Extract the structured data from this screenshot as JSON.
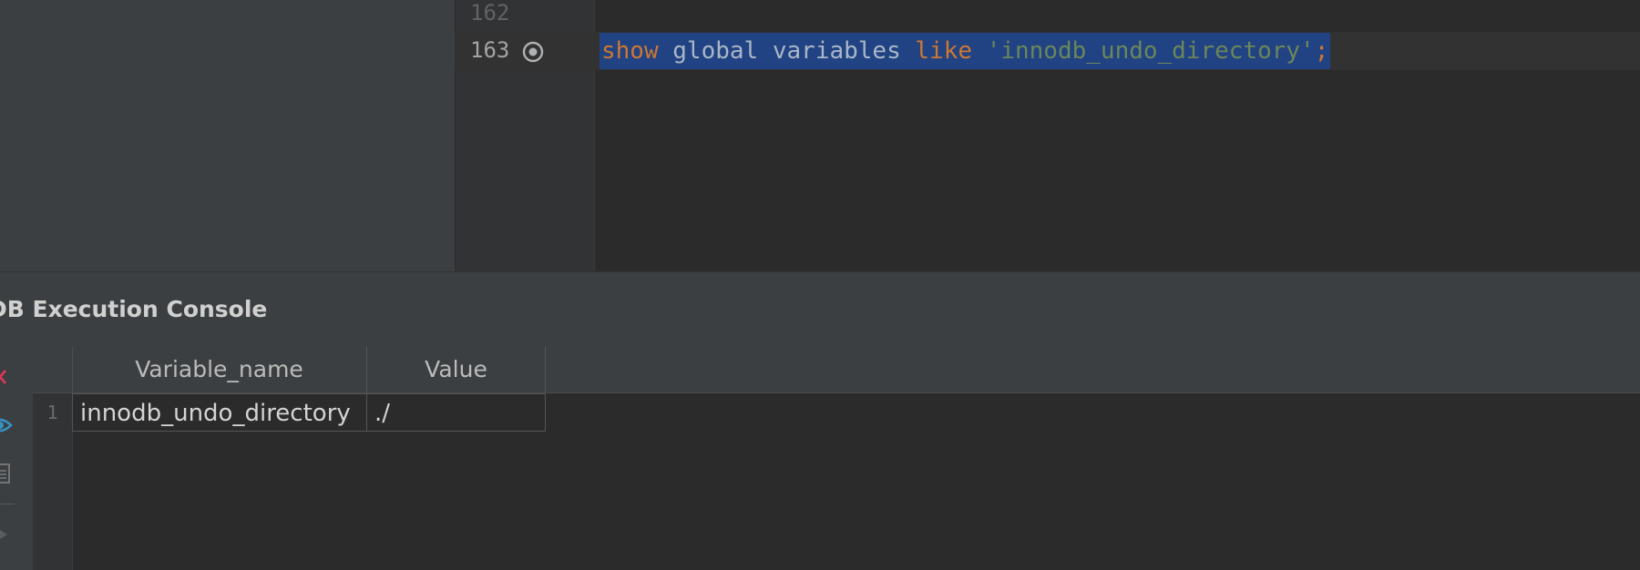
{
  "editor": {
    "lines": [
      {
        "number": "162"
      },
      {
        "number": "163"
      }
    ],
    "code": {
      "kw_show": "show",
      "id_global": "global",
      "id_variables": "variables",
      "kw_like": "like",
      "str_value": "'innodb_undo_directory'",
      "punct": ";"
    },
    "exec_icon": "execute-statement-icon"
  },
  "console": {
    "title": "DB Execution Console",
    "toolbar_icons": [
      "close-icon",
      "eye-icon",
      "document-icon",
      "play-icon"
    ]
  },
  "results": {
    "columns": [
      "Variable_name",
      "Value"
    ],
    "rows": [
      {
        "index": "1",
        "cells": [
          "innodb_undo_directory",
          "./"
        ]
      }
    ]
  },
  "colors": {
    "keyword": "#cc7832",
    "string": "#6a8759",
    "selection": "#214283",
    "close_icon": "#e0365c",
    "eye_icon": "#3592c4"
  }
}
